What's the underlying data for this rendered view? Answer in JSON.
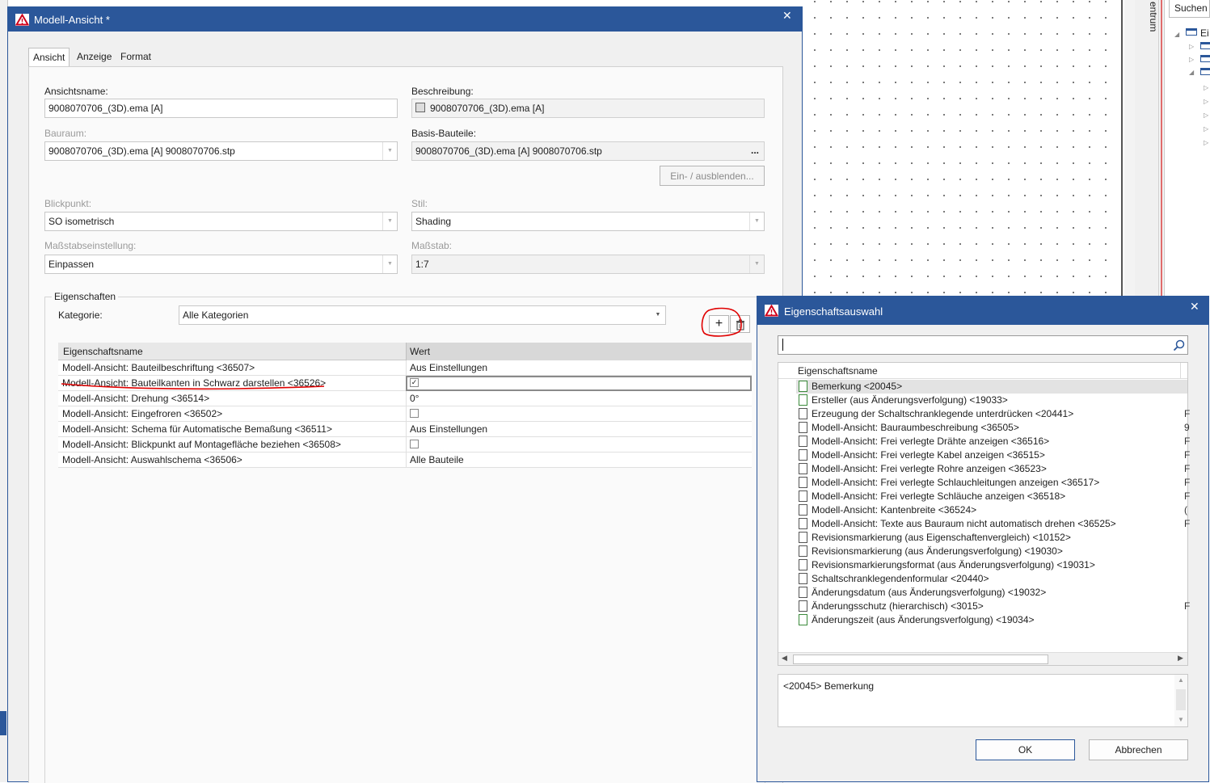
{
  "background": {
    "search_label": "Suchen",
    "vertical_tab_label": "entrum",
    "tree_root_label": "Ei"
  },
  "dialog_main": {
    "title": "Modell-Ansicht *",
    "tabs": [
      "Ansicht",
      "Anzeige",
      "Format"
    ],
    "fields": {
      "ansichtsname_label": "Ansichtsname:",
      "ansichtsname_value": "9008070706_(3D).ema [A]",
      "beschreibung_label": "Beschreibung:",
      "beschreibung_value": "9008070706_(3D).ema [A]",
      "bauraum_label": "Bauraum:",
      "bauraum_value": "9008070706_(3D).ema [A] 9008070706.stp",
      "basis_label": "Basis-Bauteile:",
      "basis_value": "9008070706_(3D).ema [A] 9008070706.stp",
      "basis_browse": "...",
      "einausblenden_button": "Ein- / ausblenden...",
      "blickpunkt_label": "Blickpunkt:",
      "blickpunkt_value": "SO isometrisch",
      "stil_label": "Stil:",
      "stil_value": "Shading",
      "massstabseinstellung_label": "Maßstabseinstellung:",
      "massstabseinstellung_value": "Einpassen",
      "massstab_label": "Maßstab:",
      "massstab_value": "1:7"
    },
    "properties": {
      "group_label": "Eigenschaften",
      "kategorie_label": "Kategorie:",
      "kategorie_value": "Alle Kategorien",
      "add_button": "+",
      "columns": [
        "Eigenschaftsname",
        "Wert"
      ],
      "rows": [
        {
          "name": "Modell-Ansicht: Bauteilbeschriftung <36507>",
          "value": "Aus Einstellungen"
        },
        {
          "name": "Modell-Ansicht: Bauteilkanten in Schwarz darstellen <36526>",
          "value": "✓"
        },
        {
          "name": "Modell-Ansicht: Drehung <36514>",
          "value": "0°"
        },
        {
          "name": "Modell-Ansicht: Eingefroren <36502>",
          "value": ""
        },
        {
          "name": "Modell-Ansicht: Schema für Automatische Bemaßung <36511>",
          "value": "Aus Einstellungen"
        },
        {
          "name": "Modell-Ansicht: Blickpunkt auf Montagefläche beziehen <36508>",
          "value": ""
        },
        {
          "name": "Modell-Ansicht: Auswahlschema <36506>",
          "value": "Alle Bauteile"
        }
      ]
    }
  },
  "dialog_select": {
    "title": "Eigenschaftsauswahl",
    "search_value": "",
    "column": "Eigenschaftsname",
    "items": [
      {
        "label": "Bemerkung <20045>",
        "trail": ""
      },
      {
        "label": "Ersteller (aus Änderungsverfolgung) <19033>",
        "trail": ""
      },
      {
        "label": "Erzeugung der Schaltschranklegende unterdrücken <20441>",
        "trail": "F"
      },
      {
        "label": "Modell-Ansicht: Bauraumbeschreibung <36505>",
        "trail": "9"
      },
      {
        "label": "Modell-Ansicht: Frei verlegte Drähte anzeigen <36516>",
        "trail": "F"
      },
      {
        "label": "Modell-Ansicht: Frei verlegte Kabel anzeigen <36515>",
        "trail": "F"
      },
      {
        "label": "Modell-Ansicht: Frei verlegte Rohre anzeigen <36523>",
        "trail": "F"
      },
      {
        "label": "Modell-Ansicht: Frei verlegte Schlauchleitungen anzeigen <36517>",
        "trail": "F"
      },
      {
        "label": "Modell-Ansicht: Frei verlegte Schläuche anzeigen <36518>",
        "trail": "F"
      },
      {
        "label": "Modell-Ansicht: Kantenbreite <36524>",
        "trail": "("
      },
      {
        "label": "Modell-Ansicht: Texte aus Bauraum nicht automatisch drehen <36525>",
        "trail": "F"
      },
      {
        "label": "Revisionsmarkierung (aus Eigenschaftenvergleich) <10152>",
        "trail": ""
      },
      {
        "label": "Revisionsmarkierung (aus Änderungsverfolgung) <19030>",
        "trail": ""
      },
      {
        "label": "Revisionsmarkierungsformat (aus Änderungsverfolgung) <19031>",
        "trail": ""
      },
      {
        "label": "Schaltschranklegendenformular <20440>",
        "trail": ""
      },
      {
        "label": "Änderungsdatum (aus Änderungsverfolgung) <19032>",
        "trail": ""
      },
      {
        "label": "Änderungsschutz (hierarchisch) <3015>",
        "trail": "F"
      },
      {
        "label": "Änderungszeit (aus Änderungsverfolgung) <19034>",
        "trail": ""
      }
    ],
    "description": "<20045> Bemerkung",
    "ok_label": "OK",
    "cancel_label": "Abbrechen"
  },
  "colors": {
    "titlebar": "#2b579a",
    "annotation": "#e00000"
  }
}
